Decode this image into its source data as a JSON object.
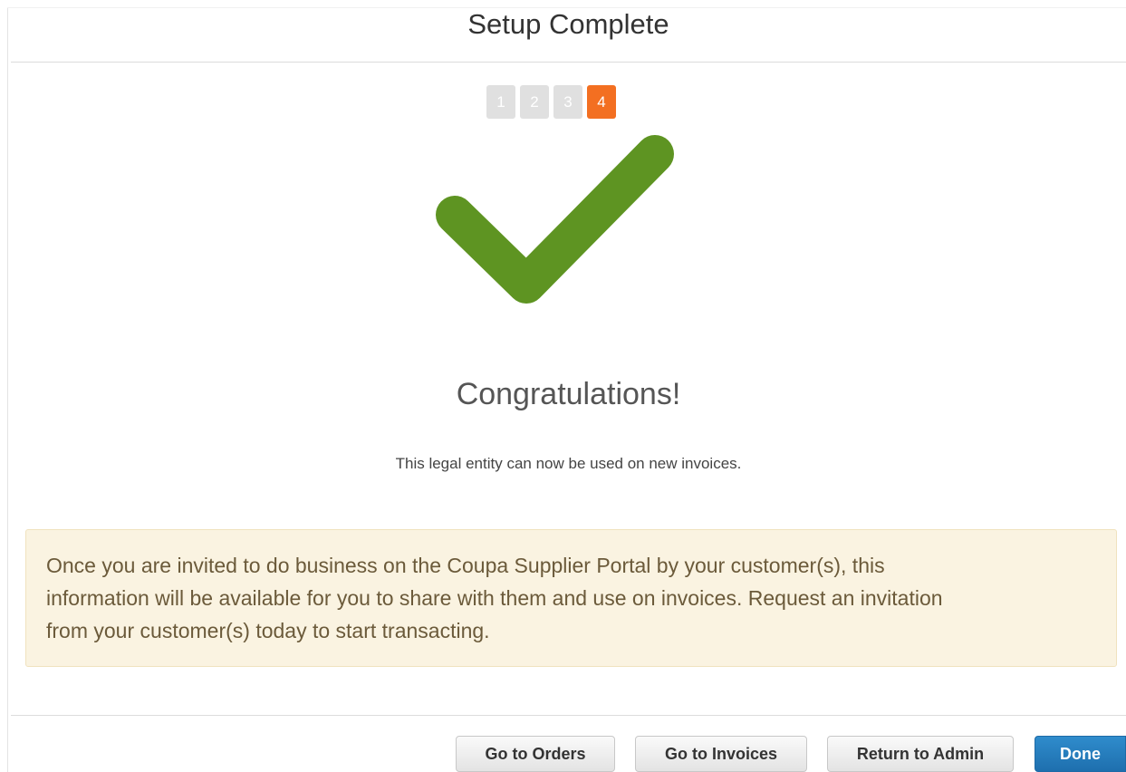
{
  "dialog": {
    "title": "Setup Complete"
  },
  "steps": {
    "items": [
      "1",
      "2",
      "3",
      "4"
    ],
    "active_step": "4"
  },
  "status_icon": "checkmark-icon",
  "colors": {
    "check_green": "#5e9422",
    "active_step": "#f36f21",
    "primary_button": "#1e6fae",
    "notice_background": "#faf3e1"
  },
  "message": {
    "headline": "Congratulations!",
    "subtext": "This legal entity can now be used on new invoices."
  },
  "notice": {
    "line1": "Once you are invited to do business on the Coupa Supplier Portal by your customer(s), this",
    "line2": "information will be available for you to share with them and use on invoices. Request an invitation",
    "line3": "from your customer(s) today to start transacting."
  },
  "buttons": {
    "go_to_orders": "Go to Orders",
    "go_to_invoices": "Go to Invoices",
    "return_to_admin": "Return to Admin",
    "done": "Done"
  }
}
